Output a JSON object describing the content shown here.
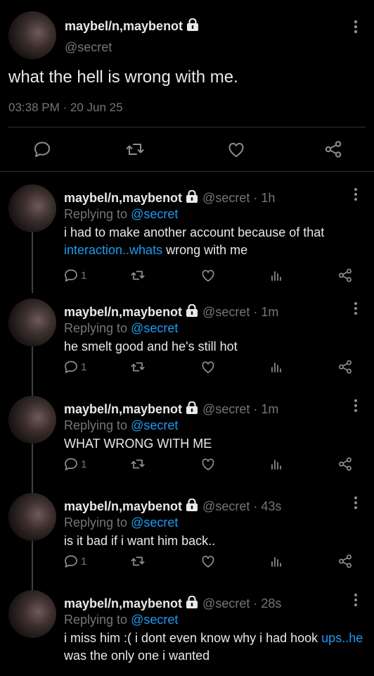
{
  "main_tweet": {
    "display_name": "maybel/n,maybenot",
    "handle": "@secret",
    "text": "what the hell is wrong with me.",
    "time": "03:38 PM",
    "dot": "·",
    "date": "20 Jun 25"
  },
  "replies": [
    {
      "display_name": "maybel/n,maybenot",
      "handle": "@secret",
      "dot": "·",
      "time": "1h",
      "replying_prefix": "Replying to ",
      "replying_to": "@secret",
      "text_before": "i had to make another account because of that ",
      "text_link": "interaction..whats",
      "text_after": " wrong with me",
      "reply_count": "1"
    },
    {
      "display_name": "maybel/n,maybenot",
      "handle": "@secret",
      "dot": "·",
      "time": "1m",
      "replying_prefix": "Replying to ",
      "replying_to": "@secret",
      "text_before": "he smelt good and he's still hot",
      "text_link": "",
      "text_after": "",
      "reply_count": "1"
    },
    {
      "display_name": "maybel/n,maybenot",
      "handle": "@secret",
      "dot": "·",
      "time": "1m",
      "replying_prefix": "Replying to ",
      "replying_to": "@secret",
      "text_before": "WHAT WRONG WITH ME",
      "text_link": "",
      "text_after": "",
      "reply_count": "1"
    },
    {
      "display_name": "maybel/n,maybenot",
      "handle": "@secret",
      "dot": "·",
      "time": "43s",
      "replying_prefix": "Replying to ",
      "replying_to": "@secret",
      "text_before": "is it bad if i want him back..",
      "text_link": "",
      "text_after": "",
      "reply_count": "1"
    },
    {
      "display_name": "maybel/n,maybenot",
      "handle": "@secret",
      "dot": "·",
      "time": "28s",
      "replying_prefix": "Replying to ",
      "replying_to": "@secret",
      "text_before": "i miss him :( i dont even know why i had hook ",
      "text_link": "ups..he",
      "text_after": " was the only one i wanted",
      "reply_count": ""
    }
  ],
  "icons": {
    "lock": "lock-icon",
    "more": "more-vertical-icon",
    "reply": "reply-icon",
    "retweet": "retweet-icon",
    "like": "heart-icon",
    "views": "bar-chart-icon",
    "share": "share-icon"
  },
  "colors": {
    "background": "#000000",
    "text": "#e7e9ea",
    "secondary": "#71767b",
    "link": "#1d9bf0",
    "divider": "#2f3336"
  }
}
